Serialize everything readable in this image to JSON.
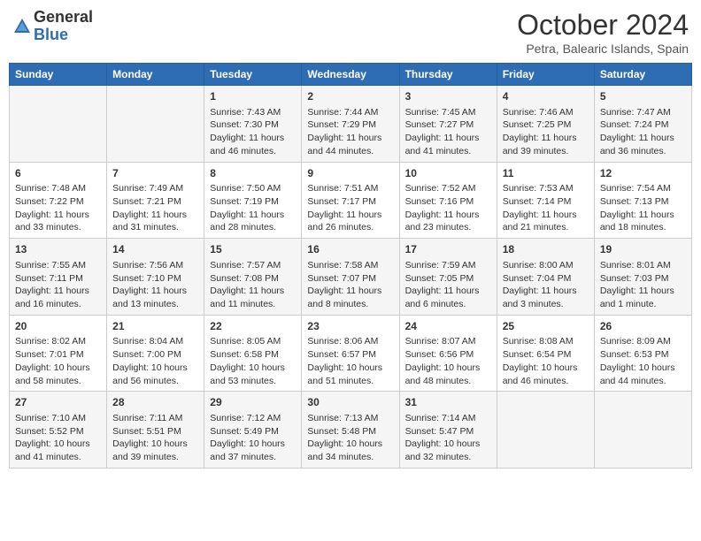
{
  "header": {
    "logo_general": "General",
    "logo_blue": "Blue",
    "month_title": "October 2024",
    "location": "Petra, Balearic Islands, Spain"
  },
  "days_of_week": [
    "Sunday",
    "Monday",
    "Tuesday",
    "Wednesday",
    "Thursday",
    "Friday",
    "Saturday"
  ],
  "weeks": [
    [
      {
        "day": "",
        "info": ""
      },
      {
        "day": "",
        "info": ""
      },
      {
        "day": "1",
        "info": "Sunrise: 7:43 AM\nSunset: 7:30 PM\nDaylight: 11 hours and 46 minutes."
      },
      {
        "day": "2",
        "info": "Sunrise: 7:44 AM\nSunset: 7:29 PM\nDaylight: 11 hours and 44 minutes."
      },
      {
        "day": "3",
        "info": "Sunrise: 7:45 AM\nSunset: 7:27 PM\nDaylight: 11 hours and 41 minutes."
      },
      {
        "day": "4",
        "info": "Sunrise: 7:46 AM\nSunset: 7:25 PM\nDaylight: 11 hours and 39 minutes."
      },
      {
        "day": "5",
        "info": "Sunrise: 7:47 AM\nSunset: 7:24 PM\nDaylight: 11 hours and 36 minutes."
      }
    ],
    [
      {
        "day": "6",
        "info": "Sunrise: 7:48 AM\nSunset: 7:22 PM\nDaylight: 11 hours and 33 minutes."
      },
      {
        "day": "7",
        "info": "Sunrise: 7:49 AM\nSunset: 7:21 PM\nDaylight: 11 hours and 31 minutes."
      },
      {
        "day": "8",
        "info": "Sunrise: 7:50 AM\nSunset: 7:19 PM\nDaylight: 11 hours and 28 minutes."
      },
      {
        "day": "9",
        "info": "Sunrise: 7:51 AM\nSunset: 7:17 PM\nDaylight: 11 hours and 26 minutes."
      },
      {
        "day": "10",
        "info": "Sunrise: 7:52 AM\nSunset: 7:16 PM\nDaylight: 11 hours and 23 minutes."
      },
      {
        "day": "11",
        "info": "Sunrise: 7:53 AM\nSunset: 7:14 PM\nDaylight: 11 hours and 21 minutes."
      },
      {
        "day": "12",
        "info": "Sunrise: 7:54 AM\nSunset: 7:13 PM\nDaylight: 11 hours and 18 minutes."
      }
    ],
    [
      {
        "day": "13",
        "info": "Sunrise: 7:55 AM\nSunset: 7:11 PM\nDaylight: 11 hours and 16 minutes."
      },
      {
        "day": "14",
        "info": "Sunrise: 7:56 AM\nSunset: 7:10 PM\nDaylight: 11 hours and 13 minutes."
      },
      {
        "day": "15",
        "info": "Sunrise: 7:57 AM\nSunset: 7:08 PM\nDaylight: 11 hours and 11 minutes."
      },
      {
        "day": "16",
        "info": "Sunrise: 7:58 AM\nSunset: 7:07 PM\nDaylight: 11 hours and 8 minutes."
      },
      {
        "day": "17",
        "info": "Sunrise: 7:59 AM\nSunset: 7:05 PM\nDaylight: 11 hours and 6 minutes."
      },
      {
        "day": "18",
        "info": "Sunrise: 8:00 AM\nSunset: 7:04 PM\nDaylight: 11 hours and 3 minutes."
      },
      {
        "day": "19",
        "info": "Sunrise: 8:01 AM\nSunset: 7:03 PM\nDaylight: 11 hours and 1 minute."
      }
    ],
    [
      {
        "day": "20",
        "info": "Sunrise: 8:02 AM\nSunset: 7:01 PM\nDaylight: 10 hours and 58 minutes."
      },
      {
        "day": "21",
        "info": "Sunrise: 8:04 AM\nSunset: 7:00 PM\nDaylight: 10 hours and 56 minutes."
      },
      {
        "day": "22",
        "info": "Sunrise: 8:05 AM\nSunset: 6:58 PM\nDaylight: 10 hours and 53 minutes."
      },
      {
        "day": "23",
        "info": "Sunrise: 8:06 AM\nSunset: 6:57 PM\nDaylight: 10 hours and 51 minutes."
      },
      {
        "day": "24",
        "info": "Sunrise: 8:07 AM\nSunset: 6:56 PM\nDaylight: 10 hours and 48 minutes."
      },
      {
        "day": "25",
        "info": "Sunrise: 8:08 AM\nSunset: 6:54 PM\nDaylight: 10 hours and 46 minutes."
      },
      {
        "day": "26",
        "info": "Sunrise: 8:09 AM\nSunset: 6:53 PM\nDaylight: 10 hours and 44 minutes."
      }
    ],
    [
      {
        "day": "27",
        "info": "Sunrise: 7:10 AM\nSunset: 5:52 PM\nDaylight: 10 hours and 41 minutes."
      },
      {
        "day": "28",
        "info": "Sunrise: 7:11 AM\nSunset: 5:51 PM\nDaylight: 10 hours and 39 minutes."
      },
      {
        "day": "29",
        "info": "Sunrise: 7:12 AM\nSunset: 5:49 PM\nDaylight: 10 hours and 37 minutes."
      },
      {
        "day": "30",
        "info": "Sunrise: 7:13 AM\nSunset: 5:48 PM\nDaylight: 10 hours and 34 minutes."
      },
      {
        "day": "31",
        "info": "Sunrise: 7:14 AM\nSunset: 5:47 PM\nDaylight: 10 hours and 32 minutes."
      },
      {
        "day": "",
        "info": ""
      },
      {
        "day": "",
        "info": ""
      }
    ]
  ]
}
